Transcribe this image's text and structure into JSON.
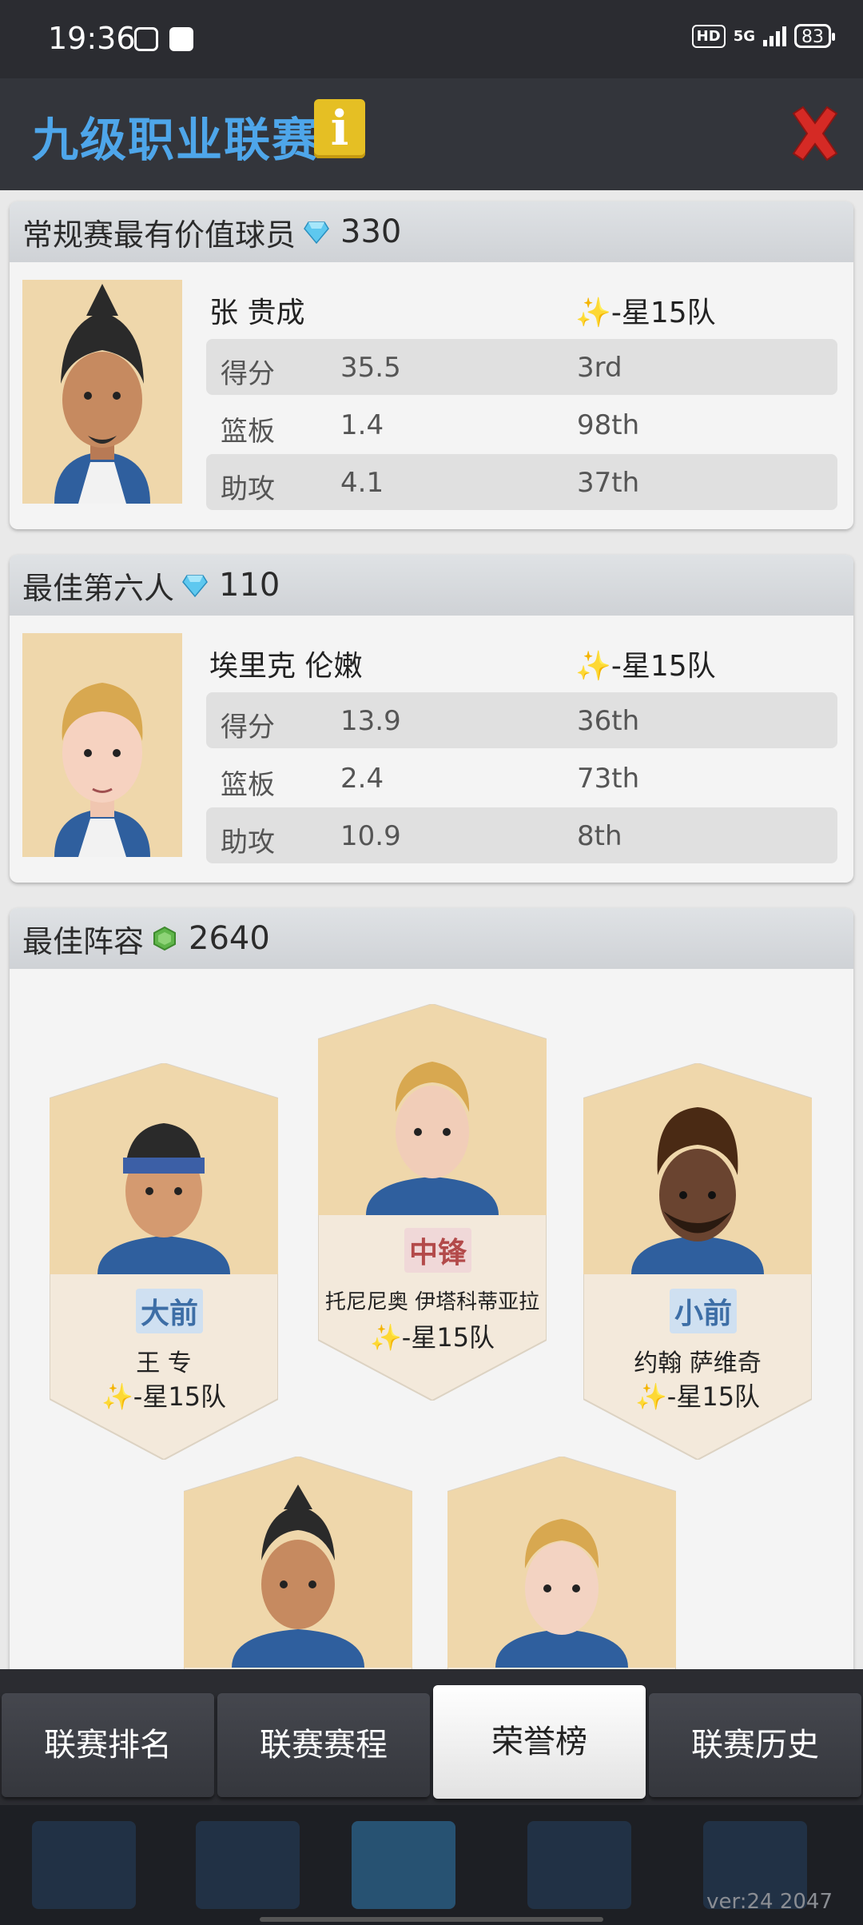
{
  "status_bar": {
    "time": "19:36",
    "hd": "HD",
    "network": "5G",
    "battery": "83"
  },
  "header": {
    "title": "九级职业联赛",
    "info_label": "i",
    "close_label": "✕"
  },
  "mvp": {
    "title": "常规赛最有价值球员",
    "reward": "330",
    "player_name": "张 贵成",
    "team": "✨-星15队",
    "stats": [
      {
        "label": "得分",
        "value": "35.5",
        "rank": "3rd"
      },
      {
        "label": "篮板",
        "value": "1.4",
        "rank": "98th"
      },
      {
        "label": "助攻",
        "value": "4.1",
        "rank": "37th"
      }
    ]
  },
  "sixth_man": {
    "title": "最佳第六人",
    "reward": "110",
    "player_name": "埃里克 伦嫩",
    "team": "✨-星15队",
    "stats": [
      {
        "label": "得分",
        "value": "13.9",
        "rank": "36th"
      },
      {
        "label": "篮板",
        "value": "2.4",
        "rank": "73th"
      },
      {
        "label": "助攻",
        "value": "10.9",
        "rank": "8th"
      }
    ]
  },
  "lineup": {
    "title": "最佳阵容",
    "reward": "2640",
    "players": [
      {
        "position": "大前",
        "name": "王 专",
        "team": "✨-星15队"
      },
      {
        "position": "中锋",
        "name": "托尼尼奥 伊塔科蒂亚拉",
        "team": "✨-星15队"
      },
      {
        "position": "小前",
        "name": "约翰 萨维奇",
        "team": "✨-星15队"
      }
    ]
  },
  "tabs": [
    {
      "label": "联赛排名"
    },
    {
      "label": "联赛赛程"
    },
    {
      "label": "荣誉榜"
    },
    {
      "label": "联赛历史"
    }
  ],
  "footer": {
    "version": "ver:24  2047"
  },
  "colors": {
    "title_blue": "#4ea6ea",
    "close_red": "#d52a25",
    "info_yellow": "#e5bf24",
    "portrait_bg": "#efd7ab"
  }
}
